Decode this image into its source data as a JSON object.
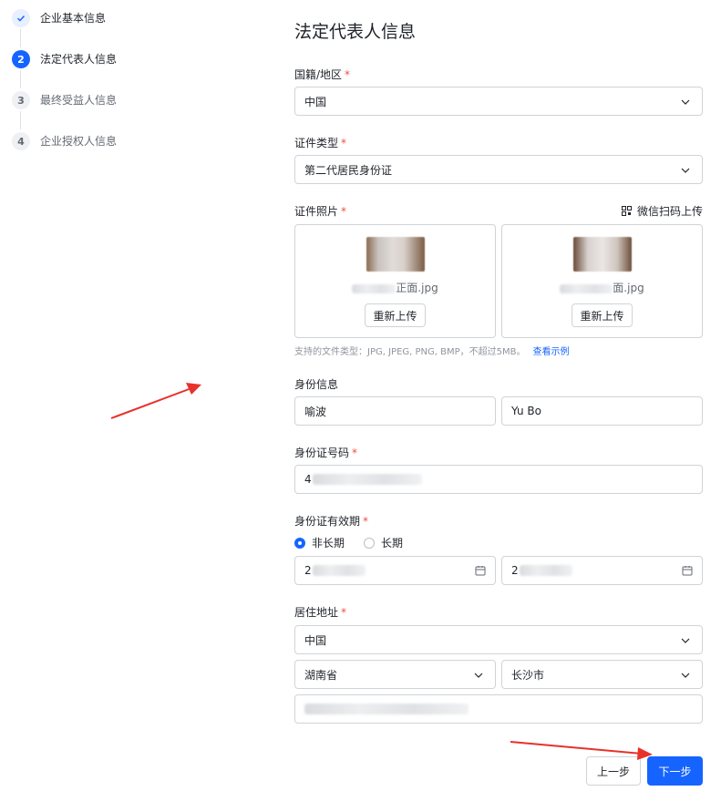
{
  "steps": [
    {
      "num": "",
      "label": "企业基本信息",
      "state": "done"
    },
    {
      "num": "2",
      "label": "法定代表人信息",
      "state": "active"
    },
    {
      "num": "3",
      "label": "最终受益人信息",
      "state": "todo"
    },
    {
      "num": "4",
      "label": "企业授权人信息",
      "state": "todo"
    }
  ],
  "form": {
    "title": "法定代表人信息",
    "nationality": {
      "label": "国籍/地区",
      "value": "中国"
    },
    "id_type": {
      "label": "证件类型",
      "value": "第二代居民身份证"
    },
    "id_photo": {
      "label": "证件照片",
      "wechat_upload": "微信扫码上传",
      "front_file_suffix": "正面.jpg",
      "back_file_suffix": "面.jpg",
      "reupload_label": "重新上传",
      "hint": "支持的文件类型：JPG, JPEG, PNG, BMP，不超过5MB。",
      "hint_link": "查看示例"
    },
    "identity": {
      "label": "身份信息",
      "name_cn": "喻波",
      "name_en": "Yu Bo"
    },
    "id_number": {
      "label": "身份证号码",
      "value_prefix": "4"
    },
    "validity": {
      "label": "身份证有效期",
      "option_short": "非长期",
      "option_long": "长期",
      "start_prefix": "2",
      "end_prefix": "2"
    },
    "address": {
      "label": "居住地址",
      "country": "中国",
      "province": "湖南省",
      "city": "长沙市"
    }
  },
  "buttons": {
    "prev": "上一步",
    "next": "下一步"
  },
  "colors": {
    "primary": "#1664ff",
    "required": "#f54a45",
    "annotation_arrow": "#e8312a"
  }
}
